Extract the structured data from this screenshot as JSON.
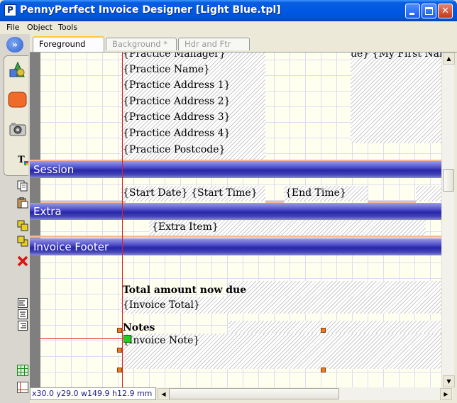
{
  "window": {
    "title": "PennyPerfect Invoice Designer [Light Blue.tpl]",
    "app_icon_letter": "P"
  },
  "menu": [
    "File",
    "Object",
    "Tools"
  ],
  "tabs": [
    "Foreground",
    "Background *",
    "Hdr and Ftr"
  ],
  "toolbar": {
    "expand_label": "»",
    "icons": [
      "shapes-tool-icon",
      "rounded-rect-tool-icon",
      "camera-tool-icon",
      "text-tool-icon",
      "copy-icon",
      "paste-icon",
      "bring-forward-icon",
      "send-backward-icon",
      "delete-icon",
      "align-left-icon",
      "align-center-icon",
      "align-right-icon",
      "grid-icon",
      "ruler-icon"
    ]
  },
  "fields": {
    "practice_manager": "{Practice Manager}",
    "my_first_name": "ue} {My First Name",
    "practice_name": "{Practice Name}",
    "address1": "{Practice Address 1}",
    "address2": "{Practice Address 2}",
    "address3": "{Practice Address 3}",
    "address4": "{Practice Address 4}",
    "postcode": "{Practice Postcode}",
    "start": "{Start Date}  {Start Time}",
    "end": "{End Time}",
    "extra_item": "{Extra Item}",
    "total_label": "Total amount now due",
    "invoice_total": "{Invoice Total}",
    "notes_label": "Notes",
    "invoice_note": "{Invoice Note}"
  },
  "bands": {
    "session": "Session",
    "extra": "Extra",
    "invoice_footer": "Invoice Footer"
  },
  "status": {
    "coords": "x30.0 y29.0 w149.9 h12.9 mm"
  }
}
